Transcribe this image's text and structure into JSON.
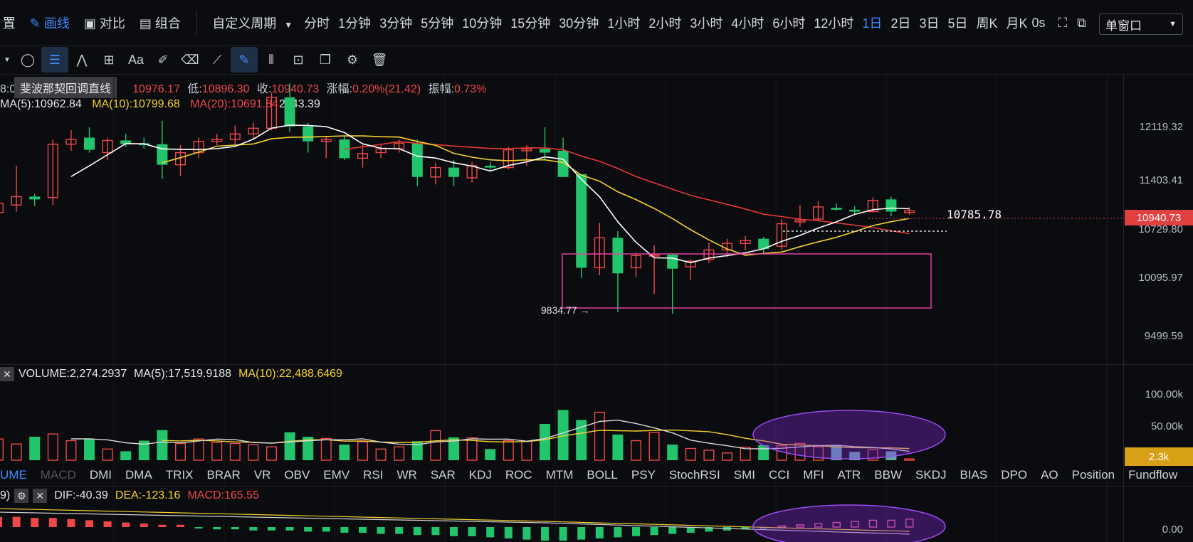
{
  "topbar": {
    "settings_label": "置",
    "draw_label": "画线",
    "compare_label": "对比",
    "combine_label": "组合",
    "custom_period": "自定义周期",
    "periods": [
      "分时",
      "1分钟",
      "3分钟",
      "5分钟",
      "10分钟",
      "15分钟",
      "30分钟",
      "1小时",
      "2小时",
      "3小时",
      "4小时",
      "6小时",
      "12小时",
      "1日",
      "2日",
      "3日",
      "5日",
      "周K",
      "月K"
    ],
    "active_period": "1日",
    "countdown": "0s",
    "window_mode": "单窗口"
  },
  "tooltip": "斐波那契回调直线",
  "ohlc": {
    "prefix": "8:0",
    "high_value": "10976.17",
    "low_label": "低:",
    "low_value": "10896.30",
    "close_label": "收:",
    "close_value": "10940.73",
    "change_label": "涨幅:",
    "change_value": "0.20%(21.42)",
    "amp_label": "振幅:",
    "amp_value": "0.73%"
  },
  "ma": {
    "ma5": "MA(5):10962.84",
    "ma10": "MA(10):10799.68",
    "ma20": "MA(20):10691.84",
    "overlap": "2443.39"
  },
  "price_axis": [
    "12119.32",
    "11403.41",
    "10729.80",
    "10095.97",
    "9499.59"
  ],
  "last_price": "10940.73",
  "marker_price": "10785.78",
  "low_marker": "9834.77",
  "volume": {
    "label": "VOLUME:2,274.2937",
    "ma5": "MA(5):17,519.9188",
    "ma10": "MA(10):22,488.6469",
    "axis": [
      "100.00k",
      "50.00k"
    ],
    "last": "2.3k"
  },
  "indicator_tabs": [
    "UME",
    "MACD",
    "DMI",
    "DMA",
    "TRIX",
    "BRAR",
    "VR",
    "OBV",
    "EMV",
    "RSI",
    "WR",
    "SAR",
    "KDJ",
    "ROC",
    "MTM",
    "BOLL",
    "PSY",
    "StochRSI",
    "SMI",
    "CCI",
    "MFI",
    "ATR",
    "BBW",
    "SKDJ",
    "BIAS",
    "DPO",
    "AO",
    "Position",
    "Fundflow"
  ],
  "macd": {
    "prefix": "9)",
    "dif": "DIF:-40.39",
    "dea": "DEA:-123.16",
    "macd": "MACD:165.55",
    "axis": "0.00"
  },
  "colors": {
    "up": "#f04848",
    "down": "#22c56c",
    "accent": "#3d8bff",
    "ma5": "#ffffff",
    "ma10": "#f5d130",
    "ma20": "#e53935",
    "box": "#e040a0",
    "ellipse": "#8a2be2"
  },
  "chart_data": {
    "type": "candlestick",
    "price_range": [
      9300,
      12400
    ],
    "candles": [
      {
        "o": 10920,
        "h": 11200,
        "l": 10850,
        "c": 11020
      },
      {
        "o": 11000,
        "h": 11420,
        "l": 10930,
        "c": 11090
      },
      {
        "o": 11090,
        "h": 11120,
        "l": 10990,
        "c": 11060
      },
      {
        "o": 11080,
        "h": 11700,
        "l": 11000,
        "c": 11650
      },
      {
        "o": 11650,
        "h": 11800,
        "l": 11580,
        "c": 11700
      },
      {
        "o": 11720,
        "h": 11830,
        "l": 11560,
        "c": 11590
      },
      {
        "o": 11560,
        "h": 11720,
        "l": 11480,
        "c": 11690
      },
      {
        "o": 11690,
        "h": 11760,
        "l": 11620,
        "c": 11650
      },
      {
        "o": 11660,
        "h": 11720,
        "l": 11600,
        "c": 11640
      },
      {
        "o": 11650,
        "h": 11900,
        "l": 11280,
        "c": 11430
      },
      {
        "o": 11430,
        "h": 11640,
        "l": 11310,
        "c": 11560
      },
      {
        "o": 11560,
        "h": 11720,
        "l": 11500,
        "c": 11680
      },
      {
        "o": 11680,
        "h": 11760,
        "l": 11640,
        "c": 11700
      },
      {
        "o": 11700,
        "h": 11850,
        "l": 11640,
        "c": 11760
      },
      {
        "o": 11760,
        "h": 11880,
        "l": 11700,
        "c": 11820
      },
      {
        "o": 11820,
        "h": 12200,
        "l": 11800,
        "c": 12150
      },
      {
        "o": 12150,
        "h": 12300,
        "l": 11780,
        "c": 11840
      },
      {
        "o": 11840,
        "h": 11880,
        "l": 11560,
        "c": 11680
      },
      {
        "o": 11680,
        "h": 11740,
        "l": 11500,
        "c": 11700
      },
      {
        "o": 11700,
        "h": 11740,
        "l": 11480,
        "c": 11500
      },
      {
        "o": 11500,
        "h": 11640,
        "l": 11400,
        "c": 11550
      },
      {
        "o": 11560,
        "h": 11640,
        "l": 11500,
        "c": 11600
      },
      {
        "o": 11600,
        "h": 11700,
        "l": 11560,
        "c": 11660
      },
      {
        "o": 11660,
        "h": 11700,
        "l": 11200,
        "c": 11300
      },
      {
        "o": 11300,
        "h": 11450,
        "l": 11220,
        "c": 11400
      },
      {
        "o": 11400,
        "h": 11480,
        "l": 11200,
        "c": 11300
      },
      {
        "o": 11290,
        "h": 11460,
        "l": 11240,
        "c": 11420
      },
      {
        "o": 11420,
        "h": 11460,
        "l": 11360,
        "c": 11400
      },
      {
        "o": 11400,
        "h": 11620,
        "l": 11380,
        "c": 11590
      },
      {
        "o": 11580,
        "h": 11640,
        "l": 11420,
        "c": 11600
      },
      {
        "o": 11600,
        "h": 11830,
        "l": 11480,
        "c": 11560
      },
      {
        "o": 11580,
        "h": 11720,
        "l": 11300,
        "c": 11300
      },
      {
        "o": 11330,
        "h": 11330,
        "l": 10220,
        "c": 10330
      },
      {
        "o": 10330,
        "h": 10810,
        "l": 10250,
        "c": 10650
      },
      {
        "o": 10650,
        "h": 10720,
        "l": 9860,
        "c": 10270
      },
      {
        "o": 10330,
        "h": 10490,
        "l": 10230,
        "c": 10460
      },
      {
        "o": 10460,
        "h": 10570,
        "l": 10050,
        "c": 10470
      },
      {
        "o": 10470,
        "h": 10480,
        "l": 9840,
        "c": 10320
      },
      {
        "o": 10340,
        "h": 10420,
        "l": 10200,
        "c": 10400
      },
      {
        "o": 10420,
        "h": 10600,
        "l": 10380,
        "c": 10520
      },
      {
        "o": 10520,
        "h": 10640,
        "l": 10440,
        "c": 10590
      },
      {
        "o": 10590,
        "h": 10670,
        "l": 10520,
        "c": 10620
      },
      {
        "o": 10640,
        "h": 10660,
        "l": 10480,
        "c": 10530
      },
      {
        "o": 10560,
        "h": 10850,
        "l": 10520,
        "c": 10800
      },
      {
        "o": 10820,
        "h": 11000,
        "l": 10770,
        "c": 10840
      },
      {
        "o": 10850,
        "h": 11040,
        "l": 10830,
        "c": 10980
      },
      {
        "o": 10970,
        "h": 11020,
        "l": 10940,
        "c": 10950
      },
      {
        "o": 10950,
        "h": 10990,
        "l": 10900,
        "c": 10930
      },
      {
        "o": 10930,
        "h": 11080,
        "l": 10920,
        "c": 11050
      },
      {
        "o": 11060,
        "h": 11090,
        "l": 10880,
        "c": 10930
      },
      {
        "o": 10919,
        "h": 10976,
        "l": 10896,
        "c": 10940
      }
    ],
    "volume_range": [
      0,
      130000
    ],
    "volumes": [
      38000,
      29000,
      42000,
      47000,
      35000,
      38000,
      20000,
      16000,
      35000,
      54000,
      30000,
      38000,
      32000,
      30000,
      28000,
      24000,
      50000,
      42000,
      39000,
      28000,
      33000,
      20000,
      24000,
      34000,
      53000,
      41000,
      40000,
      20000,
      35000,
      34000,
      65000,
      90000,
      72000,
      86000,
      46000,
      35000,
      50000,
      28000,
      21000,
      18000,
      13000,
      23000,
      27000,
      26000,
      30000,
      24000,
      27000,
      15000,
      19000,
      16000,
      2300
    ],
    "macd_hist": [
      9,
      9,
      8,
      8,
      7,
      6,
      5,
      4,
      3,
      2,
      2,
      -1,
      -2,
      -2,
      -3,
      -3,
      -3,
      -4,
      -4,
      -5,
      -5,
      -6,
      -6,
      -7,
      -7,
      -8,
      -8,
      -9,
      -10,
      -11,
      -12,
      -12,
      -11,
      -10,
      -9,
      -8,
      -7,
      -6,
      -5,
      -4,
      -3,
      -2,
      -1,
      1,
      2,
      3,
      4,
      5,
      6,
      6,
      7
    ]
  }
}
